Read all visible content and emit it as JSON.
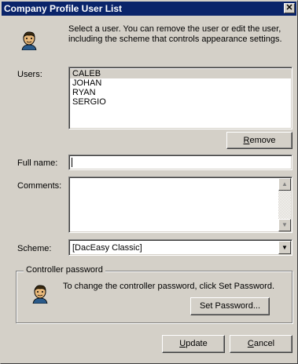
{
  "window": {
    "title": "Company Profile User List"
  },
  "intro_text": "Select a user. You can remove the user or edit the user, including the scheme that controls appearance settings.",
  "users": {
    "label": "Users:",
    "items": [
      "CALEB",
      "JOHAN",
      "RYAN",
      "SERGIO"
    ],
    "selected_index": 0
  },
  "remove_button": {
    "prefix": "",
    "accel": "R",
    "rest": "emove"
  },
  "full_name": {
    "label": "Full name:",
    "value": ""
  },
  "comments": {
    "label": "Comments:",
    "value": ""
  },
  "scheme": {
    "label": "Scheme:",
    "value": "[DacEasy Classic]"
  },
  "controller_password": {
    "legend": "Controller password",
    "text": "To change the controller password, click Set Password.",
    "button_label": "Set Password..."
  },
  "update_button": {
    "accel": "U",
    "rest": "pdate"
  },
  "cancel_button": {
    "accel": "C",
    "rest": "ancel"
  },
  "icons": {
    "user": "person-icon",
    "close": "close-icon"
  }
}
